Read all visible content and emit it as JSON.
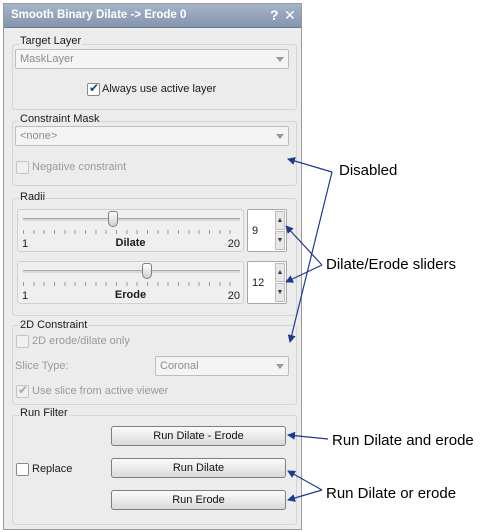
{
  "window": {
    "title": "Smooth Binary Dilate -> Erode 0",
    "help_label": "?",
    "close_label": "✕"
  },
  "target_layer": {
    "group_label": "Target Layer",
    "combo_value": "MaskLayer",
    "always_active_label": "Always use active layer",
    "always_active_checked": true
  },
  "constraint_mask": {
    "group_label": "Constraint Mask",
    "combo_value": "<none>",
    "negative_label": "Negative constraint",
    "negative_checked": false
  },
  "radii": {
    "group_label": "Radii",
    "dilate": {
      "name": "Dilate",
      "min": "1",
      "max": "20",
      "value": "9"
    },
    "erode": {
      "name": "Erode",
      "min": "1",
      "max": "20",
      "value": "12"
    }
  },
  "constraint_2d": {
    "group_label": "2D Constraint",
    "only_label": "2D erode/dilate only",
    "only_checked": false,
    "slice_type_label": "Slice Type:",
    "slice_type_value": "Coronal",
    "use_slice_label": "Use slice from active viewer",
    "use_slice_checked": true
  },
  "run_filter": {
    "group_label": "Run Filter",
    "replace_label": "Replace",
    "replace_checked": false,
    "run_dilate_erode_label": "Run Dilate - Erode",
    "run_dilate_label": "Run Dilate",
    "run_erode_label": "Run Erode"
  },
  "annotations": {
    "disabled": "Disabled",
    "sliders": "Dilate/Erode sliders",
    "run_both": "Run Dilate and erode",
    "run_either": "Run Dilate or erode"
  },
  "colors": {
    "titlebar": "#8e9bb3",
    "arrow": "#1f3a8a",
    "panel": "#ececec"
  }
}
